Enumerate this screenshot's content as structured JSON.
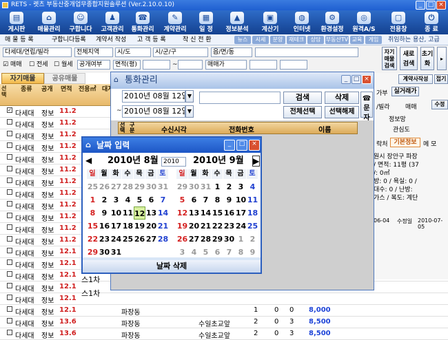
{
  "window": {
    "title": "RETS - 렛츠 부동산중개업무종합지원솔루션 (Ver.2.10.0.10)"
  },
  "toolbar": [
    {
      "label": "게시판",
      "icon": "board-icon"
    },
    {
      "label": "매물관리",
      "icon": "house-icon"
    },
    {
      "label": "구합니다",
      "icon": "people-icon"
    },
    {
      "label": "고객관리",
      "icon": "customer-icon"
    },
    {
      "label": "통화관리",
      "icon": "phone-icon"
    },
    {
      "label": "계약관리",
      "icon": "contract-icon"
    },
    {
      "label": "일 정",
      "icon": "calendar-icon"
    },
    {
      "label": "정보분석",
      "icon": "chart-icon"
    },
    {
      "label": "계산기",
      "icon": "calculator-icon"
    },
    {
      "label": "인터넷",
      "icon": "globe-icon"
    },
    {
      "label": "환경설정",
      "icon": "settings-icon"
    },
    {
      "label": "원격A/S",
      "icon": "remote-icon"
    },
    {
      "label": "전용창",
      "icon": "window-icon"
    },
    {
      "label": "종 료",
      "icon": "exit-icon"
    }
  ],
  "subbar": {
    "items": [
      "매 물 등 록",
      "구합니다등록",
      "계약서 작성",
      "고 객 등 록",
      "착 신 전 환"
    ],
    "pills": [
      "뉴스",
      "시세",
      "분양",
      "재테크",
      "상담",
      "부동산TV",
      "교육",
      "게임"
    ],
    "notice": "취임하는 용산, 고급"
  },
  "filters": {
    "category": "다세대/연립/빌라",
    "region": "전체지역",
    "sido": "시/도",
    "sigungu": "시/군/구",
    "dong": "읍/면/동",
    "sale": "매매",
    "jeonse": "전세",
    "wolse": "월세",
    "public": "공개여부",
    "area": "면적(평)",
    "tilde": "~",
    "price": "매매가",
    "btn_toggle": "자기 매물 검색",
    "btn_new": "새로 검색",
    "btn_init": "초기화"
  },
  "tabs": {
    "own": "자기매물",
    "shared": "공유매물"
  },
  "grid": {
    "headers": [
      "선택",
      "종류",
      "공개",
      "면적",
      "전용㎡",
      "대지"
    ],
    "rows": [
      {
        "type": "다세대",
        "pub": "정보",
        "area": "11.2"
      },
      {
        "type": "다세대",
        "pub": "정보",
        "area": "11.2"
      },
      {
        "type": "다세대",
        "pub": "정보",
        "area": "11.2"
      },
      {
        "type": "다세대",
        "pub": "정보",
        "area": "11.2"
      },
      {
        "type": "다세대",
        "pub": "정보",
        "area": "11.2"
      },
      {
        "type": "다세대",
        "pub": "정보",
        "area": "11.2"
      },
      {
        "type": "다세대",
        "pub": "정보",
        "area": "11.2"
      },
      {
        "type": "다세대",
        "pub": "정보",
        "area": "11.2"
      },
      {
        "type": "다세대",
        "pub": "정보",
        "area": "11.2"
      },
      {
        "type": "다세대",
        "pub": "정보",
        "area": "11.2"
      },
      {
        "type": "다세대",
        "pub": "정보",
        "area": "11.2"
      },
      {
        "type": "다세대",
        "pub": "정보",
        "area": "11.2"
      },
      {
        "type": "다세대",
        "pub": "정보",
        "area": "12.1"
      },
      {
        "type": "다세대",
        "pub": "정보",
        "area": "12.1"
      },
      {
        "type": "다세대",
        "pub": "정보",
        "area": "12.1"
      },
      {
        "type": "다세대",
        "pub": "정보",
        "area": "12.1"
      },
      {
        "type": "다세대",
        "pub": "정보",
        "area": "12.1"
      },
      {
        "type": "다세대",
        "pub": "정보",
        "area": "12.1",
        "dong": "파장동",
        "c1": "1",
        "c2": "0",
        "c3": "0",
        "price": "8,000"
      },
      {
        "type": "다세대",
        "pub": "정보",
        "area": "13.6",
        "dong": "파장동",
        "near": "수일초교앞",
        "c1": "2",
        "c2": "0",
        "c3": "3",
        "price": "8,500"
      },
      {
        "type": "다세대",
        "pub": "정보",
        "area": "13.6",
        "dong": "파장동",
        "near": "수일초교앞",
        "c1": "2",
        "c2": "0",
        "c3": "3",
        "price": "8,500"
      }
    ],
    "extra": [
      "스1차",
      "스1차"
    ]
  },
  "right_panel": {
    "tabs": [
      "계약사작성",
      "접기"
    ],
    "subtabs": [
      "가부",
      "실거래가"
    ],
    "fields": [
      "/빌라",
      "매매",
      "수정",
      "정보망",
      "관심도"
    ],
    "infotabs": [
      "락처",
      "기본정보",
      "메 모"
    ],
    "info": [
      "원시 장안구 파장",
      "/ 면적: 11평 (37",
      "/: 0㎡",
      "방: 0 / 욕실: 0 /",
      "대수: 0 / 난방:",
      "가스 / 복도: 계단"
    ],
    "dates": [
      "06-04",
      "수정일",
      "2010-07-05"
    ]
  },
  "call_dialog": {
    "title": "통화관리",
    "date_from": "2010년 08월 12일",
    "date_to": "2010년 08월 12일",
    "tilde": "~",
    "btn_search": "검색",
    "btn_delete": "삭제",
    "btn_select_all": "전체선택",
    "btn_deselect": "선택해제",
    "btn_sms": "문자",
    "cols": [
      "선택",
      "구분",
      "수신시각",
      "전화번호",
      "이름"
    ]
  },
  "date_dialog": {
    "title": "날짜 입력",
    "month1": "2010년  8월",
    "year_select": "2010",
    "month2": "2010년  9월",
    "delete_btn": "날짜 삭제",
    "weekdays": [
      "일",
      "월",
      "화",
      "수",
      "목",
      "금",
      "토"
    ],
    "cal1": [
      [
        25,
        26,
        27,
        28,
        29,
        30,
        31
      ],
      [
        1,
        2,
        3,
        4,
        5,
        6,
        7
      ],
      [
        8,
        9,
        10,
        11,
        12,
        13,
        14
      ],
      [
        15,
        16,
        17,
        18,
        19,
        20,
        21
      ],
      [
        22,
        23,
        24,
        25,
        26,
        27,
        28
      ],
      [
        29,
        30,
        31
      ]
    ],
    "cal2": [
      [
        29,
        30,
        31,
        1,
        2,
        3,
        4
      ],
      [
        5,
        6,
        7,
        8,
        9,
        10,
        11
      ],
      [
        12,
        13,
        14,
        15,
        16,
        17,
        18
      ],
      [
        19,
        20,
        21,
        22,
        23,
        24,
        25
      ],
      [
        26,
        27,
        28,
        29,
        30,
        1,
        2
      ],
      [
        3,
        4,
        5,
        6,
        7,
        8,
        9
      ]
    ],
    "selected": 12,
    "colors": {
      "sun": "#d42020",
      "sat": "#2040d0",
      "muted": "#9a9a9a",
      "weekday": "#000000",
      "selected_bg": "#d8f0a0"
    }
  }
}
